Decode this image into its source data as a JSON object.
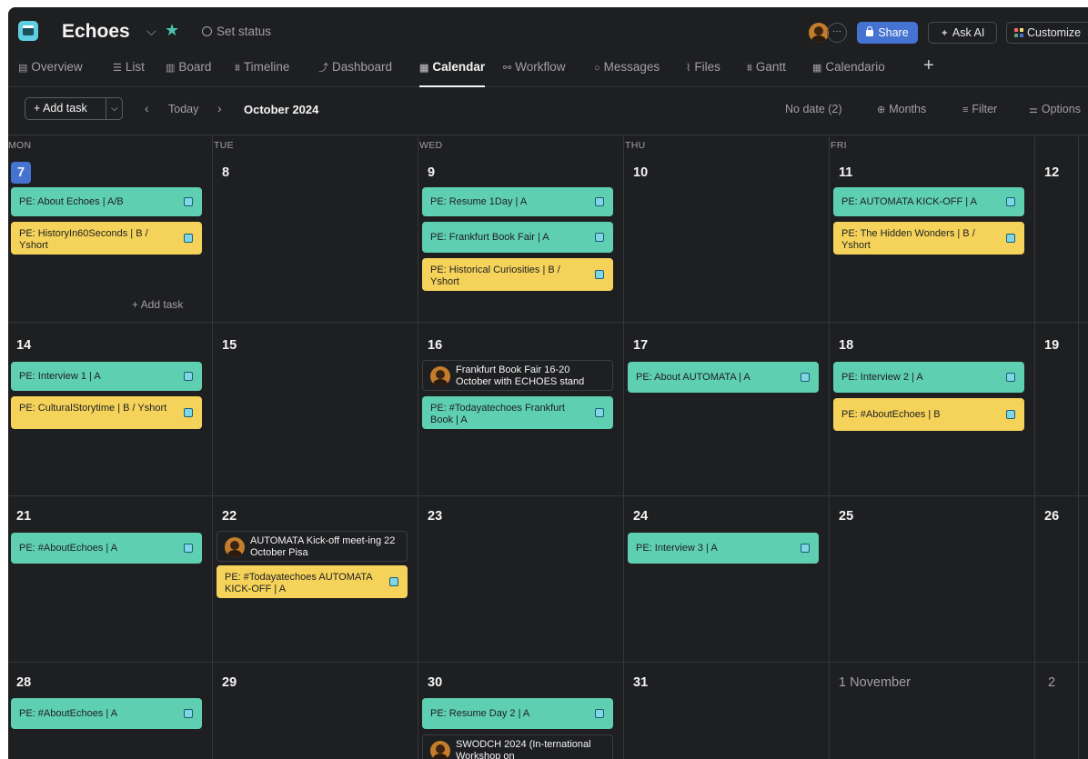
{
  "project": {
    "name": "Echoes",
    "set_status": "Set status"
  },
  "header": {
    "share": "Share",
    "ask_ai": "Ask AI",
    "customize": "Customize",
    "more": "···"
  },
  "tabs": [
    {
      "label": "Overview"
    },
    {
      "label": "List"
    },
    {
      "label": "Board"
    },
    {
      "label": "Timeline"
    },
    {
      "label": "Dashboard"
    },
    {
      "label": "Calendar"
    },
    {
      "label": "Workflow"
    },
    {
      "label": "Messages"
    },
    {
      "label": "Files"
    },
    {
      "label": "Gantt"
    },
    {
      "label": "Calendario"
    }
  ],
  "toolbar": {
    "add_task": "+ Add task",
    "today": "Today",
    "month": "October 2024",
    "no_date": "No date (2)",
    "months": "Months",
    "filter": "Filter",
    "options": "Options"
  },
  "weekdays": [
    "MON",
    "TUE",
    "WED",
    "THU",
    "FRI"
  ],
  "days": {
    "d7": "7",
    "d8": "8",
    "d9": "9",
    "d10": "10",
    "d11": "11",
    "d12": "12",
    "d14": "14",
    "d15": "15",
    "d16": "16",
    "d17": "17",
    "d18": "18",
    "d19": "19",
    "d21": "21",
    "d22": "22",
    "d23": "23",
    "d24": "24",
    "d25": "25",
    "d26": "26",
    "d28": "28",
    "d29": "29",
    "d30": "30",
    "d31": "31",
    "nov1": "1 November",
    "nov2": "2"
  },
  "add_task_inline": "+ Add task",
  "tasks": {
    "t7a": "PE: About Echoes | A/B",
    "t7b": "PE: HistoryIn60Seconds | B / Yshort",
    "t9a": "PE: Resume 1Day | A",
    "t9b": "PE: Frankfurt Book Fair | A",
    "t9c": "PE: Historical Curiosities | B / Yshort",
    "t11a": "PE: AUTOMATA KICK-OFF | A",
    "t11b": "PE: The Hidden Wonders | B / Yshort",
    "t14a": "PE: Interview 1 | A",
    "t14b": "PE: CulturalStorytime | B / Yshort",
    "e16": "Frankfurt Book Fair 16-20 October with ECHOES stand",
    "t16b": "PE: #Todayatechoes Frankfurt Book | A",
    "t17a": "PE: About AUTOMATA | A",
    "t18a": "PE: Interview 2 | A",
    "t18b": "PE: #AboutEchoes | B",
    "t21a": "PE: #AboutEchoes | A",
    "e22": "AUTOMATA Kick-off meet-ing 22 October Pisa",
    "t22b": "PE: #Todayatechoes AUTOMATA KICK-OFF | A",
    "t24a": "PE: Interview 3 | A",
    "t28a": "PE: #AboutEchoes | A",
    "t30a": "PE: Resume Day 2 | A",
    "e30": "SWODCH 2024 (In-ternational Workshop on"
  },
  "colors": {
    "green_task": "#5fcfb1",
    "yellow_task": "#f5d35b",
    "accent": "#4573d2",
    "background": "#1e1f21"
  }
}
